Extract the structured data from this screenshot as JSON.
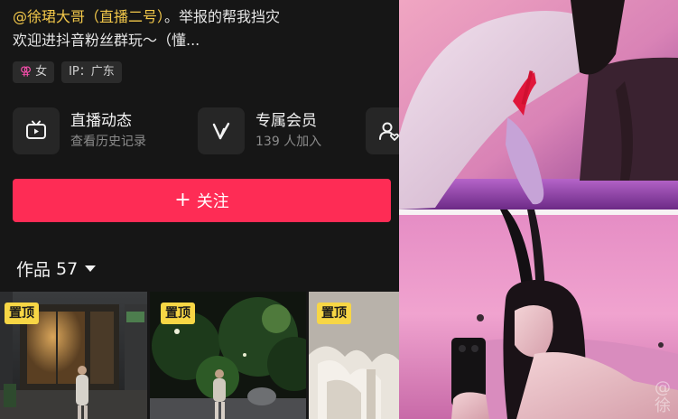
{
  "profile": {
    "bio_mention": "@徐珺大哥（直播二号）",
    "bio_line1_rest": "。举报的帮我挡灾",
    "bio_line2": "欢迎进抖音粉丝群玩～（懂..."
  },
  "tags": {
    "gender_symbol": "⚢",
    "gender": "女",
    "ip": "IP：广东"
  },
  "features": [
    {
      "title": "直播动态",
      "subtitle": "查看历史记录",
      "icon": "tv-icon"
    },
    {
      "title": "专属会员",
      "subtitle": "139 人加入",
      "icon": "v-icon"
    },
    {
      "title": "",
      "subtitle": "",
      "icon": "user-heart-icon"
    }
  ],
  "follow_button": {
    "plus": "+",
    "label": "关注"
  },
  "works": {
    "label": "作品",
    "count": "57"
  },
  "thumbnails": [
    {
      "pin_label": "置顶"
    },
    {
      "pin_label": "置顶"
    },
    {
      "pin_label": "置顶"
    }
  ],
  "watermark": {
    "symbol": "@",
    "text": "徐"
  },
  "colors": {
    "background": "#161616",
    "follow_button": "#fe2c55",
    "mention": "#f3c84a",
    "pin_badge": "#f7d645",
    "gender": "#ff4fb0"
  }
}
